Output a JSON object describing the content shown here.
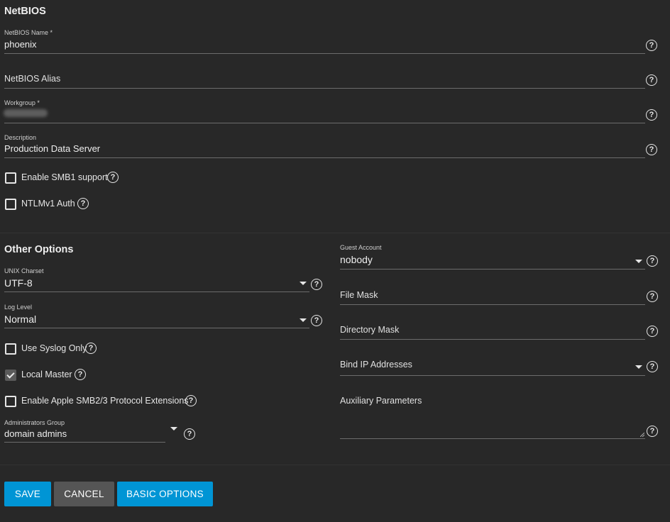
{
  "netbios": {
    "title": "NetBIOS",
    "name_label": "NetBIOS Name *",
    "name_value": "phoenix",
    "alias_placeholder": "NetBIOS Alias",
    "workgroup_label": "Workgroup *",
    "workgroup_value": "",
    "description_label": "Description",
    "description_value": "Production Data Server",
    "smb1_label": "Enable SMB1 support",
    "smb1_checked": false,
    "ntlmv1_label": "NTLMv1 Auth",
    "ntlmv1_checked": false
  },
  "other": {
    "title": "Other Options",
    "unix_charset_label": "UNIX Charset",
    "unix_charset_value": "UTF-8",
    "log_level_label": "Log Level",
    "log_level_value": "Normal",
    "syslog_label": "Use Syslog Only",
    "syslog_checked": false,
    "local_master_label": "Local Master",
    "local_master_checked": true,
    "apple_label": "Enable Apple SMB2/3 Protocol Extensions",
    "apple_checked": false,
    "admin_group_label": "Administrators Group",
    "admin_group_value": "domain admins",
    "guest_label": "Guest Account",
    "guest_value": "nobody",
    "file_mask_placeholder": "File Mask",
    "dir_mask_placeholder": "Directory Mask",
    "bind_ip_placeholder": "Bind IP Addresses",
    "aux_placeholder": "Auxiliary Parameters"
  },
  "actions": {
    "save": "SAVE",
    "cancel": "CANCEL",
    "basic": "BASIC OPTIONS"
  },
  "icons": {
    "help": "question-circle-icon",
    "caret": "caret-down-icon",
    "check": "check-icon"
  },
  "colors": {
    "background": "#282828",
    "primary": "#0095d5",
    "secondary": "#555555"
  }
}
